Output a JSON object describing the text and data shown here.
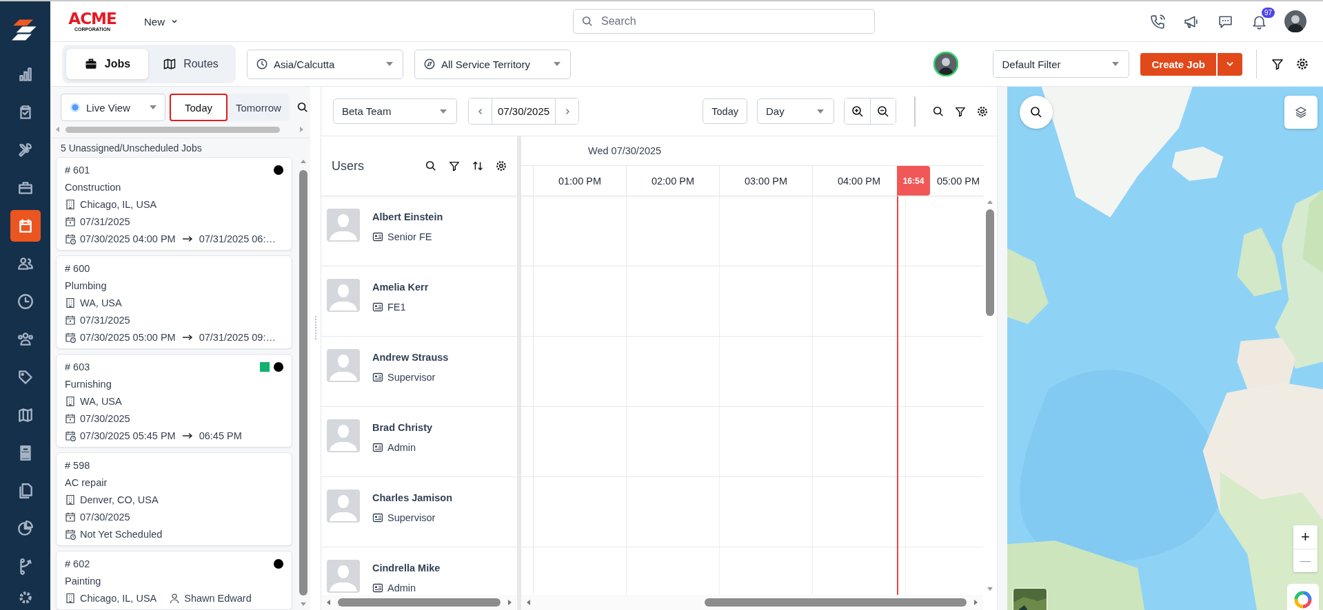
{
  "sidebar": {
    "items": [
      {
        "selected": false
      },
      {
        "selected": false
      },
      {
        "selected": false
      },
      {
        "selected": false
      },
      {
        "selected": true
      },
      {
        "selected": false
      },
      {
        "selected": false
      },
      {
        "selected": false
      },
      {
        "selected": false
      },
      {
        "selected": false
      },
      {
        "selected": false
      },
      {
        "selected": false
      },
      {
        "selected": false
      },
      {
        "selected": false
      }
    ]
  },
  "top_bar": {
    "logo": {
      "wordmark": "ACME",
      "tagline": "CORPORATION"
    },
    "new_menu": "New",
    "search": {
      "placeholder": "Search"
    },
    "notification_count": "97"
  },
  "toolbar": {
    "tabs": [
      {
        "label": "Jobs",
        "selected": true
      },
      {
        "label": "Routes",
        "selected": false
      }
    ],
    "timezone": "Asia/Calcutta",
    "territory": "All Service Territory",
    "filter": "Default Filter",
    "create_button": "Create Job"
  },
  "jobs_panel": {
    "view": "Live View",
    "day_tabs": [
      {
        "label": "Today",
        "selected": true
      },
      {
        "label": "Tomorrow",
        "selected": false
      }
    ],
    "count_label": "5 Unassigned/Unscheduled Jobs",
    "jobs": [
      {
        "number": "# 601",
        "category": "Construction",
        "location": "Chicago, IL, USA",
        "date": "07/31/2025",
        "schedule_start": "07/30/2025 04:00 PM",
        "schedule_end": "07/31/2025 06:…",
        "markers": [
          {
            "kind": "dot",
            "color": "#000000"
          }
        ]
      },
      {
        "number": "# 600",
        "category": "Plumbing",
        "location": "WA, USA",
        "date": "07/31/2025",
        "schedule_start": "07/30/2025 05:00 PM",
        "schedule_end": "07/31/2025 09:…"
      },
      {
        "number": "# 603",
        "category": "Furnishing",
        "location": "WA, USA",
        "date": "07/30/2025",
        "schedule_start": "07/30/2025 05:45 PM",
        "schedule_end": "06:45 PM",
        "markers": [
          {
            "kind": "square",
            "color": "#10b26c"
          },
          {
            "kind": "dot",
            "color": "#000000"
          }
        ]
      },
      {
        "number": "# 598",
        "category": "AC repair",
        "location": "Denver, CO, USA",
        "date": "07/30/2025",
        "schedule_start": "Not Yet Scheduled"
      },
      {
        "number": "# 602",
        "category": "Painting",
        "location": "Chicago, IL, USA",
        "assignee": "Shawn Edward",
        "markers": [
          {
            "kind": "dot",
            "color": "#000000"
          }
        ]
      }
    ]
  },
  "scheduler": {
    "team": "Beta Team",
    "date": "07/30/2025",
    "today_button": "Today",
    "range": "Day",
    "users_title": "Users",
    "day_label": "Wed 07/30/2025",
    "hours": [
      "01:00 PM",
      "02:00 PM",
      "03:00 PM",
      "04:00 PM",
      "05:00 PM"
    ],
    "now_label": "16:54",
    "users": [
      {
        "name": "Albert Einstein",
        "role": "Senior FE"
      },
      {
        "name": "Amelia Kerr",
        "role": "FE1"
      },
      {
        "name": "Andrew Strauss",
        "role": "Supervisor"
      },
      {
        "name": "Brad Christy",
        "role": "Admin"
      },
      {
        "name": "Charles Jamison",
        "role": "Supervisor"
      },
      {
        "name": "Cindrella Mike",
        "role": "Admin"
      }
    ]
  },
  "map": {
    "zoom_in": "+",
    "zoom_out": "—"
  }
}
